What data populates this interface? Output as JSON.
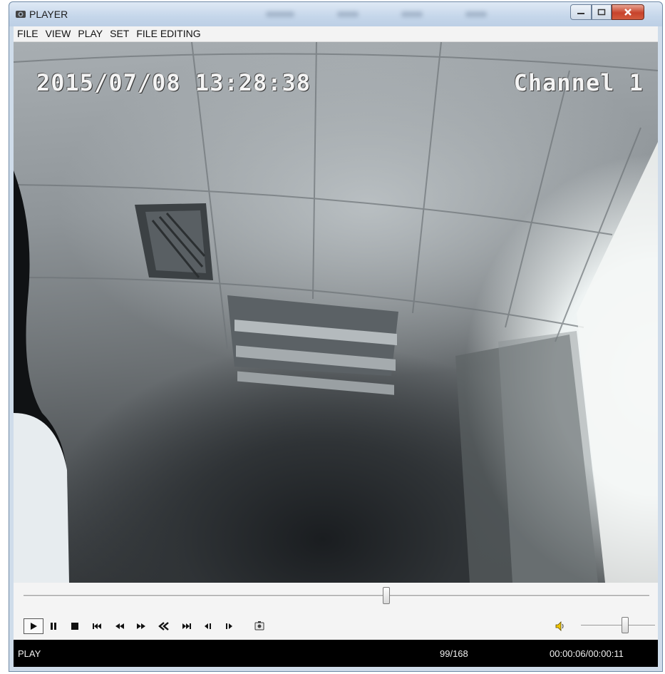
{
  "window": {
    "title": "PLAYER"
  },
  "menu": {
    "items": [
      "FILE",
      "VIEW",
      "PLAY",
      "SET",
      "FILE EDITING"
    ]
  },
  "video": {
    "timestamp": "2015/07/08 13:28:38",
    "channel": "Channel 1"
  },
  "playback": {
    "seek_fraction": 0.58,
    "volume_fraction": 0.6
  },
  "controls": {
    "icons": [
      "play-icon",
      "pause-icon",
      "stop-icon",
      "previous-file-icon",
      "slow-icon",
      "fast-icon",
      "rewind-icon",
      "next-file-icon",
      "previous-frame-icon",
      "next-frame-icon",
      "snapshot-icon",
      "volume-icon"
    ]
  },
  "status": {
    "state": "PLAY",
    "frame": "99/168",
    "time": "00:00:06/00:00:11"
  },
  "colors": {
    "status_bg": "#000000",
    "osd_text": "#f4f4f4",
    "close_button": "#c7432b"
  }
}
